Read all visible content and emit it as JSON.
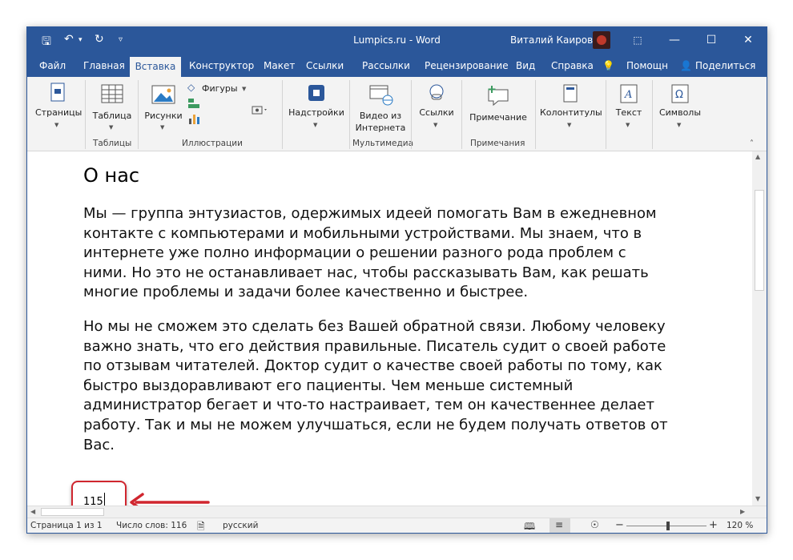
{
  "titlebar": {
    "doc_title": "Lumpics.ru  -  Word",
    "user": "Виталий Каиров",
    "save_icon": "save-icon",
    "undo_icon": "undo-icon",
    "redo_icon": "redo-icon"
  },
  "tabs": [
    "Файл",
    "Главная",
    "Вставка",
    "Конструктор",
    "Макет",
    "Ссылки",
    "Рассылки",
    "Рецензирование",
    "Вид",
    "Справка",
    "Помощн",
    "Поделиться"
  ],
  "ribbon": {
    "pages": "Страницы",
    "table": "Таблица",
    "tables_group": "Таблицы",
    "pictures": "Рисунки",
    "shapes": "Фигуры",
    "illustrations_group": "Иллюстрации",
    "addins": "Надстройки",
    "video1": "Видео из",
    "video2": "Интернета",
    "media_group": "Мультимедиа",
    "links": "Ссылки",
    "comment": "Примечание",
    "comments_group": "Примечания",
    "headerfooter": "Колонтитулы",
    "text": "Текст",
    "symbols": "Символы"
  },
  "document": {
    "heading": "О нас",
    "para1": [
      "Мы — группа энтузиастов, одержимых идеей помогать Вам в ежедневном",
      "контакте с компьютерами и мобильными устройствами. Мы знаем, что в",
      "интернете уже полно информации о решении разного рода проблем с",
      "ними. Но это не останавливает нас, чтобы рассказывать Вам, как решать",
      "многие проблемы и задачи более качественно и быстрее."
    ],
    "para2": [
      "Но мы не сможем это сделать без Вашей обратной связи. Любому человеку",
      "важно знать, что его действия правильные. Писатель судит о своей работе",
      "по отзывам читателей. Доктор судит о качестве своей работы по тому, как",
      "быстро выздоравливают его пациенты. Чем меньше системный",
      "администратор бегает и что-то настраивает, тем он качественнее делает",
      "работу. Так и мы не можем улучшаться, если не будем получать ответов от",
      "Вас."
    ],
    "typed": "115"
  },
  "status": {
    "page": "Страница 1 из 1",
    "words": "Число слов: 116",
    "lang": "русский",
    "zoom": "120 %"
  },
  "colors": {
    "accent": "#2b579a",
    "arrow": "#d0262f"
  }
}
